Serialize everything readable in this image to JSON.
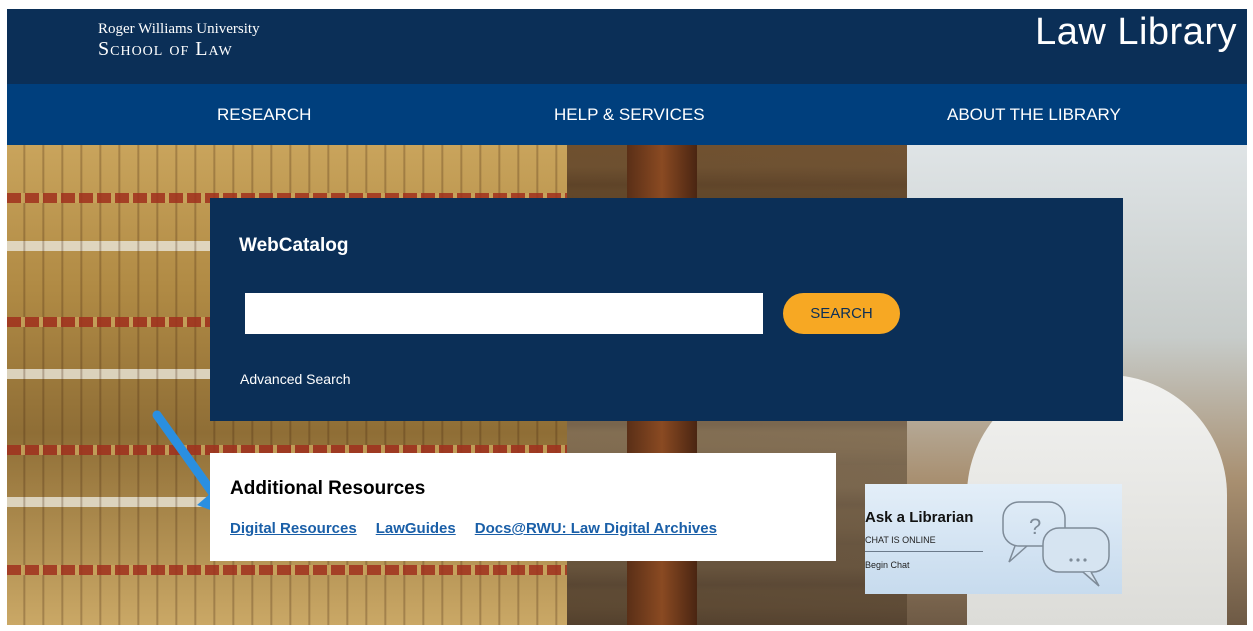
{
  "header": {
    "logo_line1": "Roger Williams University",
    "logo_line2": "School of Law",
    "site_title": "Law Library",
    "colors": {
      "header_bg": "#0b2f57",
      "nav_bg": "#003f7d"
    }
  },
  "nav": {
    "items": [
      {
        "label": "RESEARCH"
      },
      {
        "label": "HELP & SERVICES"
      },
      {
        "label": "ABOUT THE LIBRARY"
      }
    ]
  },
  "catalog": {
    "title": "WebCatalog",
    "search_value": "",
    "search_placeholder": "",
    "search_button": "SEARCH",
    "advanced_link": "Advanced Search",
    "colors": {
      "button": "#f7a823"
    }
  },
  "resources": {
    "title": "Additional Resources",
    "links": [
      {
        "label": "Digital Resources"
      },
      {
        "label": "LawGuides"
      },
      {
        "label": "Docs@RWU: Law Digital Archives"
      }
    ]
  },
  "ask_librarian": {
    "title": "Ask a Librarian",
    "status": "CHAT IS ONLINE",
    "action": "Begin Chat",
    "icon": "chat-bubbles-icon"
  },
  "annotation": {
    "icon": "blue-arrow-icon",
    "color": "#2a8fe0"
  }
}
